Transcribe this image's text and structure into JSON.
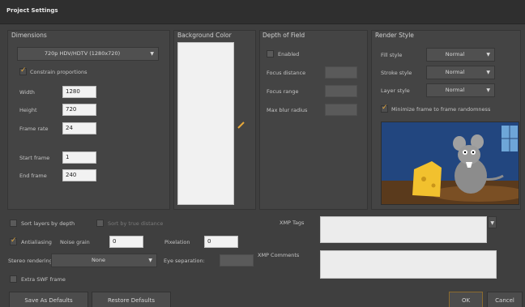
{
  "window": {
    "title": "Project Settings"
  },
  "dimensions": {
    "title": "Dimensions",
    "preset": "720p HDV/HDTV (1280x720)",
    "constrain_label": "Constrain proportions",
    "width_label": "Width",
    "width_value": "1280",
    "height_label": "Height",
    "height_value": "720",
    "framerate_label": "Frame rate",
    "framerate_value": "24",
    "start_label": "Start frame",
    "start_value": "1",
    "end_label": "End frame",
    "end_value": "240"
  },
  "background": {
    "title": "Background Color",
    "swatch_color": "#f1f1f1"
  },
  "dof": {
    "title": "Depth of Field",
    "enabled_label": "Enabled",
    "focus_distance_label": "Focus distance",
    "focus_range_label": "Focus range",
    "max_blur_label": "Max blur radius"
  },
  "render": {
    "title": "Render Style",
    "fill_label": "Fill style",
    "fill_value": "Normal",
    "stroke_label": "Stroke style",
    "stroke_value": "Normal",
    "layer_label": "Layer style",
    "layer_value": "Normal",
    "minimize_label": "Minimize frame to frame randomness"
  },
  "options": {
    "sort_depth_label": "Sort layers by depth",
    "sort_true_label": "Sort by true distance",
    "antialiasing_label": "Antialiasing",
    "noise_grain_label": "Noise grain",
    "noise_grain_value": "0",
    "pixelation_label": "Pixelation",
    "pixelation_value": "0",
    "stereo_label": "Stereo rendering:",
    "stereo_value": "None",
    "eye_sep_label": "Eye separation:",
    "extra_swf_label": "Extra SWF frame",
    "xmp_tags_label": "XMP Tags",
    "xmp_comments_label": "XMP Comments"
  },
  "buttons": {
    "save_defaults": "Save As Defaults",
    "restore_defaults": "Restore Defaults",
    "ok": "OK",
    "cancel": "Cancel"
  },
  "colors": {
    "accent": "#e8a83a",
    "background": "#3f3f3f"
  }
}
